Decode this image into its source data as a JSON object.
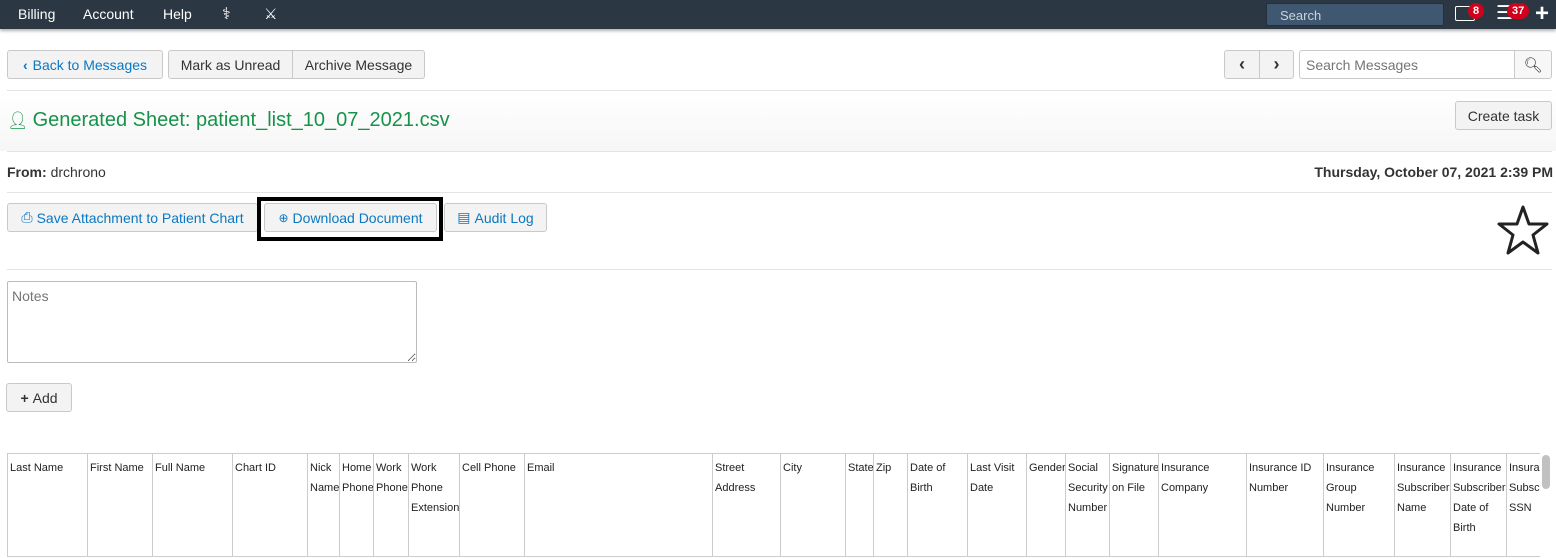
{
  "topbar": {
    "nav": [
      "Billing",
      "Account",
      "Help"
    ],
    "search_placeholder": "Search",
    "mail_count": "8",
    "tasks_count": "37"
  },
  "toolbar": {
    "back": "Back to Messages",
    "mark_unread": "Mark as Unread",
    "archive": "Archive Message",
    "search_placeholder": "Search Messages"
  },
  "message": {
    "title": "Generated Sheet: patient_list_10_07_2021.csv",
    "create_task": "Create task",
    "from_label": "From:",
    "from": "drchrono",
    "date": "Thursday, October 07, 2021 2:39 PM"
  },
  "actions": {
    "save": "Save Attachment to Patient Chart",
    "download": "Download Document",
    "audit": "Audit Log"
  },
  "notes": {
    "placeholder": "Notes",
    "add": "Add"
  },
  "table": {
    "headers": [
      "Last Name",
      "First Name",
      "Full Name",
      "Chart ID",
      "Nick Name",
      "Home Phone",
      "Work Phone",
      "Work Phone Extension",
      "Cell Phone",
      "Email",
      "Street Address",
      "City",
      "State",
      "Zip",
      "Date of Birth",
      "Last Visit Date",
      "Gender",
      "Social Security Number",
      "Signature on File",
      "Insurance Company",
      "Insurance ID Number",
      "Insurance Group Number",
      "Insurance Subscriber Name",
      "Insurance Subscriber Date of Birth",
      "Insurance Subscriber SSN"
    ]
  }
}
